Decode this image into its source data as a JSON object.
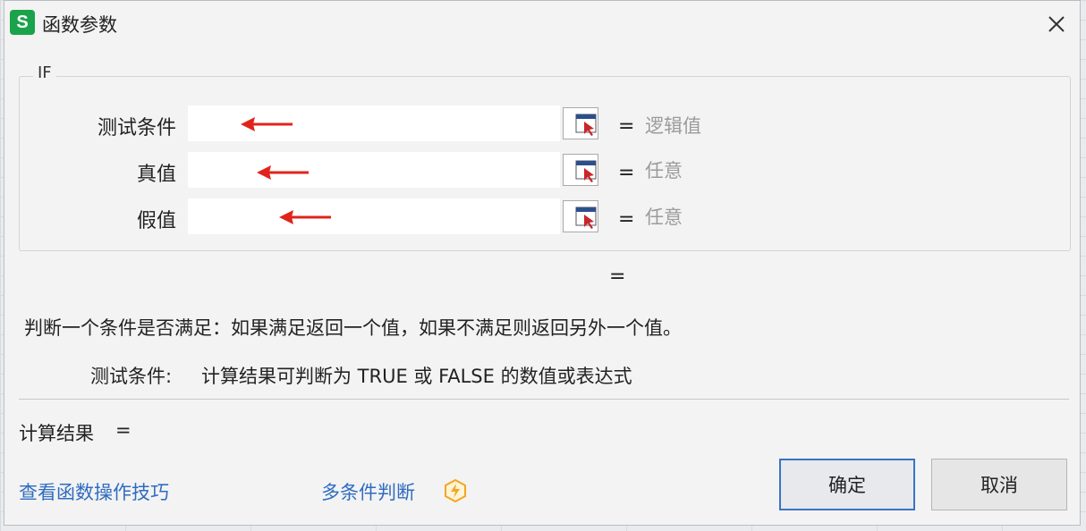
{
  "window": {
    "title": "函数参数",
    "app_logo_letter": "S"
  },
  "function_name": "IF",
  "params": [
    {
      "label": "测试条件",
      "value": "",
      "hint": "逻辑值"
    },
    {
      "label": "真值",
      "value": "",
      "hint": "任意"
    },
    {
      "label": "假值",
      "value": "",
      "hint": "任意"
    }
  ],
  "equals_sign": "=",
  "description": "判断一个条件是否满足：如果满足返回一个值，如果不满足则返回另外一个值。",
  "param_help": {
    "label": "测试条件:",
    "text": "计算结果可判断为 TRUE 或 FALSE 的数值或表达式"
  },
  "calc": {
    "label": "计算结果",
    "eq": "="
  },
  "links": {
    "tips": "查看函数操作技巧",
    "multi": "多条件判断"
  },
  "buttons": {
    "ok": "确定",
    "cancel": "取消"
  },
  "colors": {
    "accent": "#3a73c7",
    "link": "#2f6cc0",
    "logo": "#1aa34a",
    "arrow": "#e0241b",
    "badge": "#f2a623"
  }
}
